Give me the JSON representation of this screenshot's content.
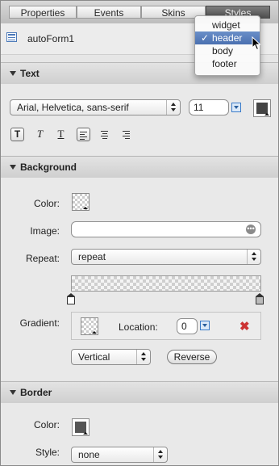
{
  "tabs": [
    "Properties",
    "Events",
    "Skins",
    "Styles"
  ],
  "active_tab": "Styles",
  "component": {
    "name": "autoForm1",
    "icon": "form-icon"
  },
  "text_section": {
    "title": "Text",
    "font": "Arial, Helvetica, sans-serif",
    "size": "11",
    "format_buttons": [
      "T",
      "T",
      "T"
    ]
  },
  "background_section": {
    "title": "Background",
    "color_label": "Color:",
    "image_label": "Image:",
    "image_value": "",
    "repeat_label": "Repeat:",
    "repeat_value": "repeat",
    "gradient_label": "Gradient:",
    "location_label": "Location:",
    "location_value": "0",
    "orientation_value": "Vertical",
    "reverse_label": "Reverse"
  },
  "border_section": {
    "title": "Border",
    "color_label": "Color:",
    "style_label": "Style:",
    "style_value": "none"
  },
  "dropdown": {
    "items": [
      "widget",
      "header",
      "body",
      "footer"
    ],
    "selected": "header",
    "check": "✓"
  },
  "colors": {
    "selection": "#4a70b0",
    "remove": "#cc3333"
  }
}
